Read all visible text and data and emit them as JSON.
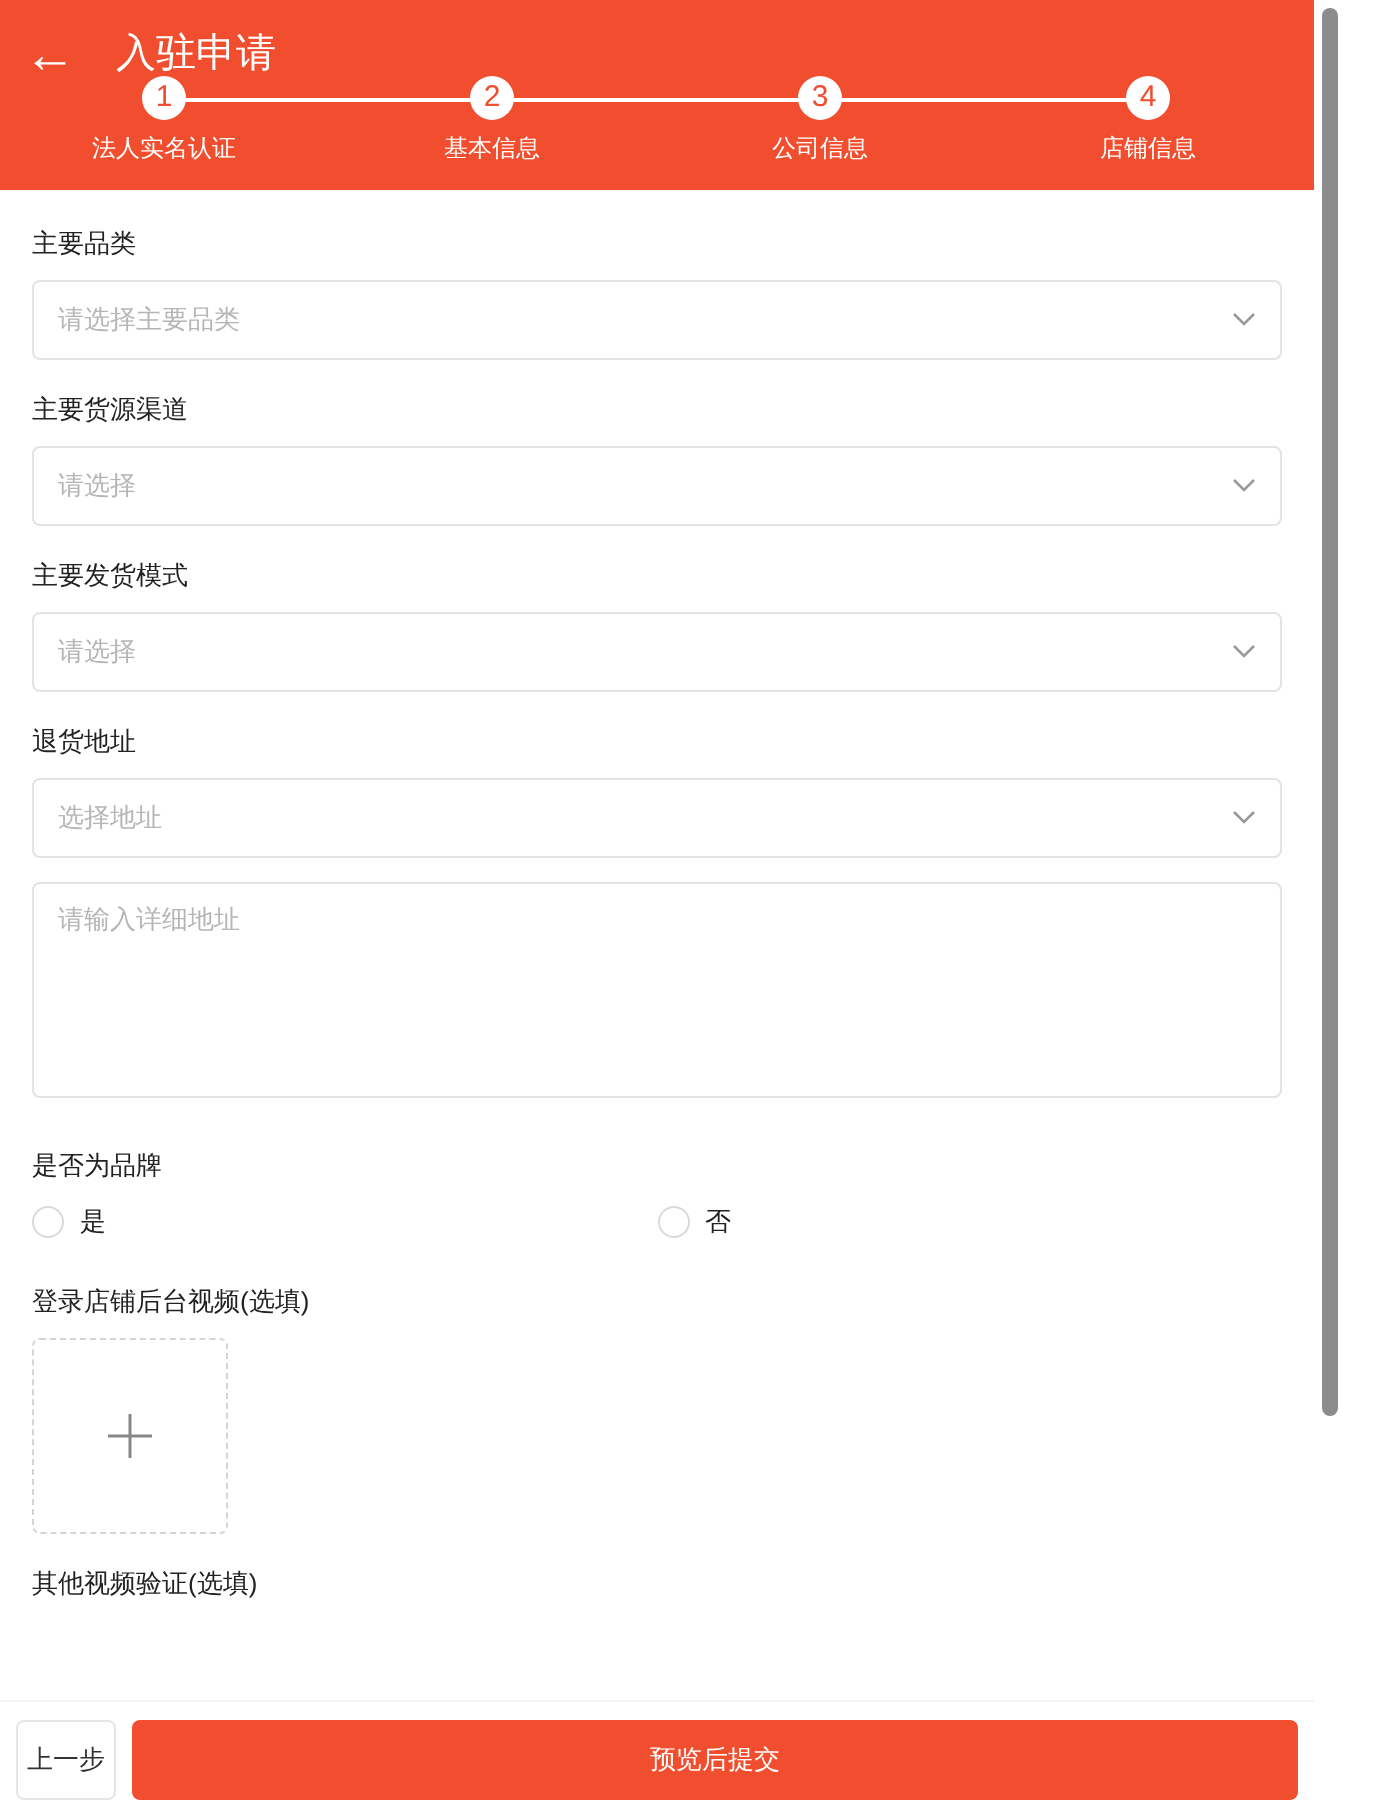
{
  "header": {
    "back_icon": "←",
    "title": "入驻申请"
  },
  "steps": [
    {
      "number": "1",
      "label": "法人实名认证"
    },
    {
      "number": "2",
      "label": "基本信息"
    },
    {
      "number": "3",
      "label": "公司信息"
    },
    {
      "number": "4",
      "label": "店铺信息"
    }
  ],
  "form": [
    {
      "kind": "select",
      "label": "主要品类",
      "placeholder": "请选择主要品类"
    },
    {
      "kind": "select",
      "label": "主要货源渠道",
      "placeholder": "请选择"
    },
    {
      "kind": "select",
      "label": "主要发货模式",
      "placeholder": "请选择"
    },
    {
      "kind": "select",
      "label": "退货地址",
      "placeholder": "选择地址"
    },
    {
      "kind": "textarea",
      "placeholder": "请输入详细地址"
    },
    {
      "kind": "radio",
      "label": "是否为品牌",
      "options": [
        {
          "label": "是",
          "selected": false
        },
        {
          "label": "否",
          "selected": false
        }
      ]
    },
    {
      "kind": "upload",
      "label": "登录店铺后台视频(选填)"
    },
    {
      "kind": "label",
      "label": "其他视频验证(选填)"
    }
  ],
  "footer": {
    "back_button": "上一步",
    "submit_button": "预览后提交"
  }
}
